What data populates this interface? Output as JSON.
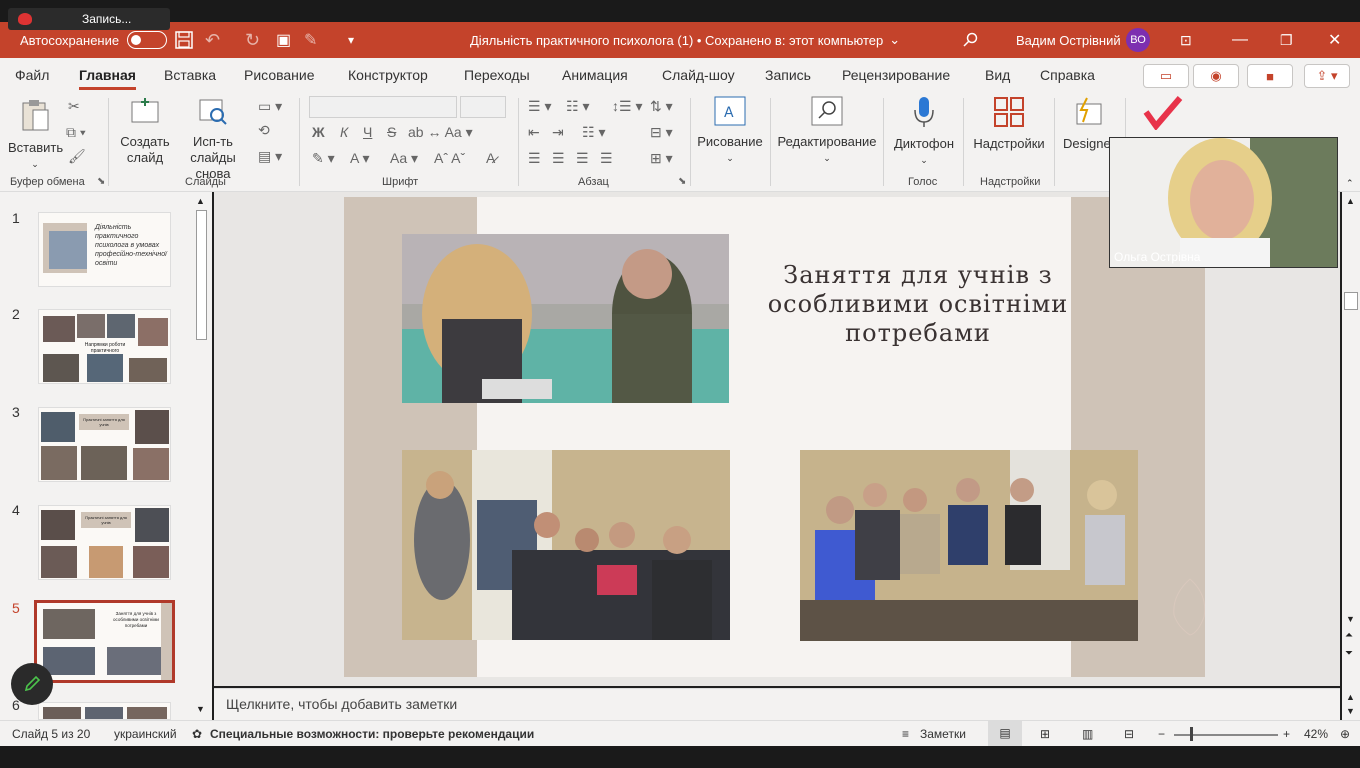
{
  "recording": {
    "label": "Запись..."
  },
  "titlebar": {
    "autosave_label": "Автосохранение",
    "doc_title": "Діяльність практичного психолога (1) • Сохранено в: этот компьютер",
    "user_name": "Вадим Острівний",
    "user_initials": "ВО"
  },
  "menu": {
    "tabs": [
      {
        "label": "Файл"
      },
      {
        "label": "Главная"
      },
      {
        "label": "Вставка"
      },
      {
        "label": "Рисование"
      },
      {
        "label": "Конструктор"
      },
      {
        "label": "Переходы"
      },
      {
        "label": "Анимация"
      },
      {
        "label": "Слайд-шоу"
      },
      {
        "label": "Запись"
      },
      {
        "label": "Рецензирование"
      },
      {
        "label": "Вид"
      },
      {
        "label": "Справка"
      }
    ]
  },
  "ribbon": {
    "paste_label": "Вставить",
    "new_slide_label": "Создать слайд",
    "reuse_label": "Исп-ть слайды снова",
    "clipboard_group": "Буфер обмена",
    "slides_group": "Слайды",
    "font_group": "Шрифт",
    "paragraph_group": "Абзац",
    "drawing_label": "Рисование",
    "editing_label": "Редактирование",
    "dictate_label": "Диктофон",
    "voice_group": "Голос",
    "addins_label": "Надстройки",
    "addins_group": "Надстройки",
    "designer_label": "Designer",
    "font_buttons": [
      "Ж",
      "К",
      "Ч",
      "S"
    ]
  },
  "thumbnails": [
    {
      "num": "1",
      "title": "Діяльність практичного психолога в умовах професійно-технічної освіти"
    },
    {
      "num": "2",
      "title": "Напрямки роботи практичного психолога"
    },
    {
      "num": "3",
      "title": "Практичні заняття для учнів"
    },
    {
      "num": "4",
      "title": "Практичні заняття для учнів"
    },
    {
      "num": "5",
      "title": "Заняття для учнів з особливими освітніми потребами"
    },
    {
      "num": "6",
      "title": ""
    }
  ],
  "slide": {
    "title": "Заняття для учнів з особливими освітніми потребами"
  },
  "notes": {
    "placeholder": "Щелкните, чтобы добавить заметки"
  },
  "video": {
    "name": "Ольга Острівна"
  },
  "status": {
    "slide_counter": "Слайд 5 из 20",
    "language": "украинский",
    "accessibility": "Специальные возможности: проверьте рекомендации",
    "notes_button": "Заметки",
    "zoom": "42%"
  },
  "colors": {
    "accent": "#c4432b",
    "slide_band": "#cfc3b7",
    "slide_bg": "#f6f3f1"
  }
}
